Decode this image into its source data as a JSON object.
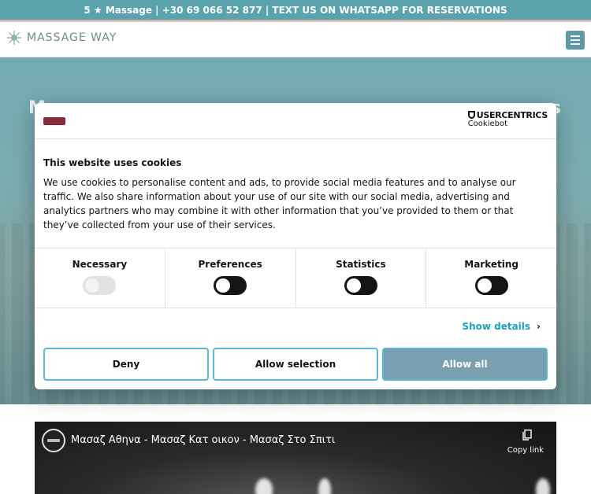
{
  "topbar": {
    "text": "5 ★ Massage | +30 69 066 52 877 | TEXT US ON WHATSAPP FOR RESERVATIONS"
  },
  "header": {
    "logo_text": "MASSAGE WAY",
    "menu_icon": "hamburger-icon"
  },
  "hero": {
    "title_left": "M",
    "title_right": "s"
  },
  "cookie_banner": {
    "provider_name": "USERCENTRICS",
    "provider_sub": "Cookiebot",
    "title": "This website uses cookies",
    "body": "We use cookies to personalise content and ads, to provide social media features and to analyse our traffic. We also share information about your use of our site with our social media, advertising and analytics partners who may combine it with other information that you’ve provided to them or that they’ve collected from your use of their services.",
    "toggles": [
      {
        "label": "Necessary",
        "state": "on-disabled"
      },
      {
        "label": "Preferences",
        "state": "off"
      },
      {
        "label": "Statistics",
        "state": "off"
      },
      {
        "label": "Marketing",
        "state": "off"
      }
    ],
    "show_details": "Show details",
    "buttons": {
      "deny": "Deny",
      "allow_selection": "Allow selection",
      "allow_all": "Allow all"
    },
    "colors": {
      "accent": "#1a9fc2",
      "primary_button": "#79a0b0",
      "button_border": "#5bbad3"
    }
  },
  "video": {
    "title": "Μασαζ Αθηνα - Μασαζ Κατ οικον - Μασαζ Στο Σπιτι",
    "copy_label": "Copy link",
    "copy_icon": "copy-icon"
  }
}
